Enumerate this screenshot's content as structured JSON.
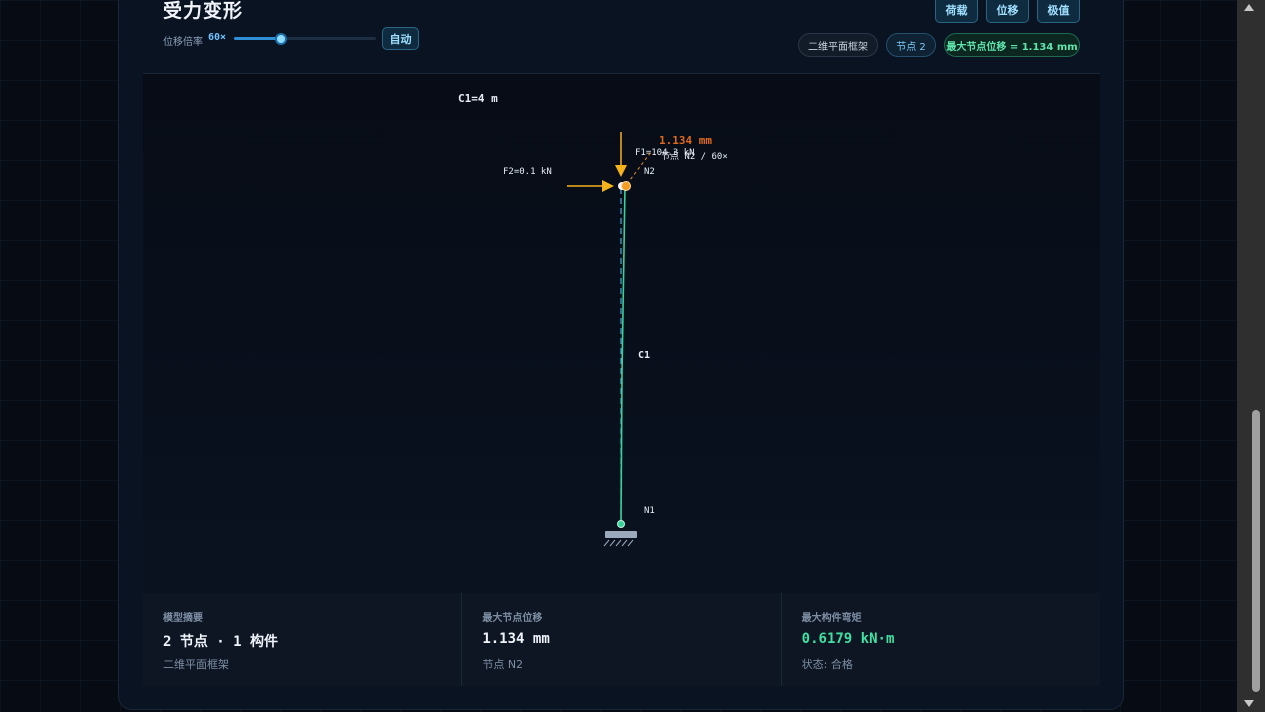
{
  "header": {
    "title": "受力变形",
    "scale_label": "位移倍率",
    "scale_value": "60×",
    "scale_fraction": 0.33,
    "auto_button": "自动",
    "view_buttons": [
      "荷载",
      "位移",
      "极值"
    ],
    "chips": {
      "model": "二维平面框架",
      "nodes": "节点 2",
      "max_disp": "最大节点位移 = 1.134 mm"
    }
  },
  "diagram": {
    "dimension_label": "C1=4 m",
    "member_label": "C1",
    "node_top": "N2",
    "node_bottom": "N1",
    "load_vertical": "F1=104.3 kN",
    "load_horizontal": "F2=0.1 kN",
    "disp_value": "1.134 mm",
    "disp_note": "节点 N2 / 60×"
  },
  "summary": [
    {
      "title": "模型摘要",
      "value": "2 节点 · 1 构件",
      "sub": "二维平面框架"
    },
    {
      "title": "最大节点位移",
      "value": "1.134 mm",
      "sub": "节点 N2"
    },
    {
      "title": "最大构件弯矩",
      "value": "0.6179 kN·m",
      "sub": "状态: 合格"
    }
  ],
  "colors": {
    "accent": "#6cc3ff",
    "load": "#f6b21b",
    "deformed": "#34d399",
    "disp": "#f08a2c"
  }
}
